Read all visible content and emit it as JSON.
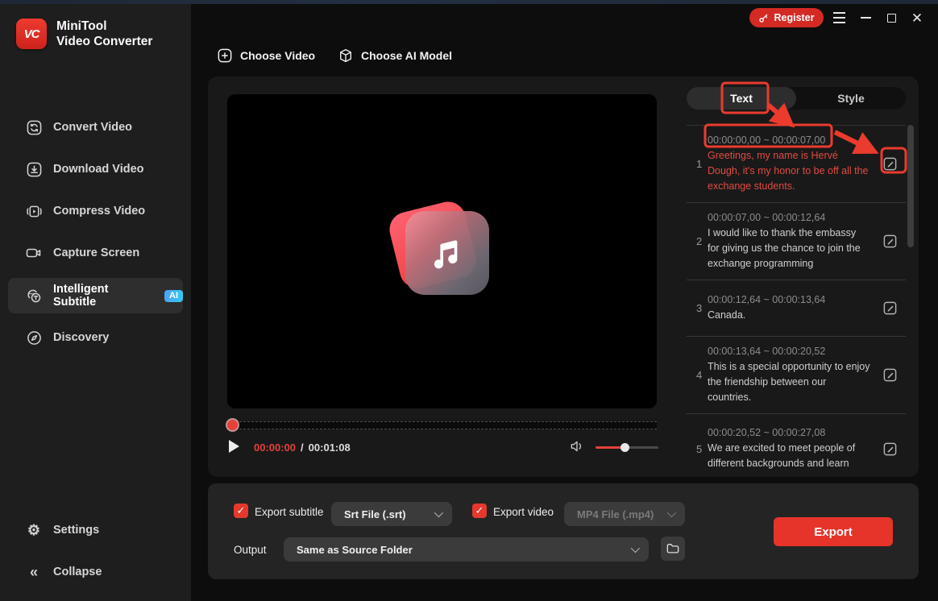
{
  "window": {
    "register": "Register"
  },
  "brand": {
    "logo": "VC",
    "line1": "MiniTool",
    "line2": "Video Converter"
  },
  "sidebar": {
    "items": [
      {
        "label": "Convert Video"
      },
      {
        "label": "Download Video"
      },
      {
        "label": "Compress Video"
      },
      {
        "label": "Capture Screen"
      },
      {
        "label": "Intelligent Subtitle",
        "badge": "AI"
      },
      {
        "label": "Discovery"
      }
    ],
    "settings": "Settings",
    "collapse": "Collapse"
  },
  "toolbar": {
    "choose_video": "Choose Video",
    "choose_ai_model": "Choose AI Model"
  },
  "player": {
    "current_time": "00:00:00",
    "time_separator": "/",
    "duration": "00:01:08"
  },
  "subtitles": {
    "tab_text": "Text",
    "tab_style": "Style",
    "entries": [
      {
        "index": "1",
        "time": "00:00:00,00 ~ 00:00:07,00",
        "text": "Greetings, my name is Hervé Dough, it's my honor to be off all the exchange students."
      },
      {
        "index": "2",
        "time": "00:00:07,00 ~ 00:00:12,64",
        "text": "I would like to thank the embassy for giving us the chance to join the exchange programming"
      },
      {
        "index": "3",
        "time": "00:00:12,64 ~ 00:00:13,64",
        "text": "Canada."
      },
      {
        "index": "4",
        "time": "00:00:13,64 ~ 00:00:20,52",
        "text": "This is a special opportunity to enjoy the friendship between our countries."
      },
      {
        "index": "5",
        "time": "00:00:20,52 ~ 00:00:27,08",
        "text": "We are excited to meet people of different backgrounds and learn"
      }
    ]
  },
  "export": {
    "subtitle_checkbox": "Export subtitle",
    "subtitle_format": "Srt File (.srt)",
    "video_checkbox": "Export video",
    "video_format": "MP4 File (.mp4)",
    "output_label": "Output",
    "output_value": "Same as Source Folder",
    "export_button": "Export",
    "check_glyph": "✓"
  },
  "colors": {
    "accent_red": "#e5413a",
    "brand_red": "#d42a24",
    "annotation_red": "#ea3b2e",
    "selected_subtitle": "#e14b41",
    "ai_badge_start": "#4aa3f5",
    "ai_badge_end": "#38c8f0"
  }
}
